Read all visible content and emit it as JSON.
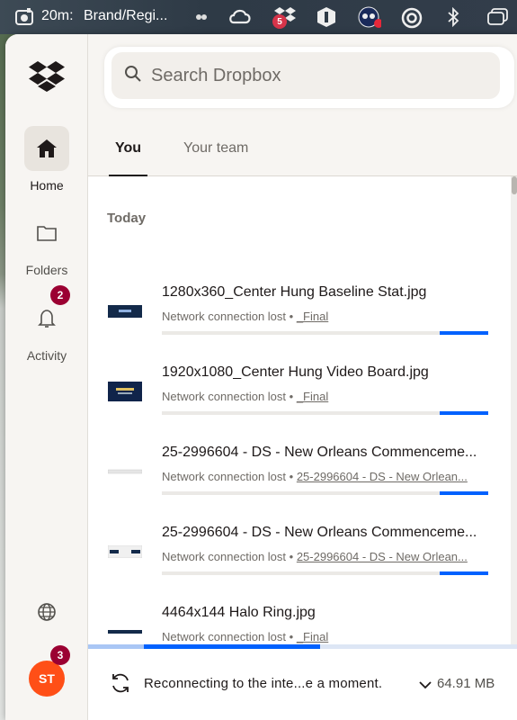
{
  "menubar": {
    "timer_label": "20m:",
    "timer_title": "Brand/Regi...",
    "dropbox_badge": "5"
  },
  "sidebar": {
    "items": [
      {
        "label": "Home",
        "icon": "home-icon"
      },
      {
        "label": "Folders",
        "icon": "folder-icon"
      },
      {
        "label": "Activity",
        "icon": "bell-icon",
        "badge": "2"
      }
    ],
    "globe_icon": "globe-icon",
    "avatar_initials": "ST",
    "avatar_badge": "3"
  },
  "search": {
    "placeholder": "Search Dropbox"
  },
  "tabs": [
    {
      "label": "You",
      "active": true
    },
    {
      "label": "Your team",
      "active": false
    }
  ],
  "section_title": "Today",
  "files": [
    {
      "name": "1280x360_Center Hung Baseline Stat.jpg",
      "status": "Network connection lost",
      "destination": "_Final",
      "progress": 0.15
    },
    {
      "name": "1920x1080_Center Hung Video Board.jpg",
      "status": "Network connection lost",
      "destination": "_Final",
      "progress": 0.15
    },
    {
      "name": "25-2996604 - DS - New Orleans Commenceme...",
      "status": "Network connection lost",
      "destination": "25-2996604 - DS - New Orlean...",
      "progress": 0.15
    },
    {
      "name": "25-2996604 - DS - New Orleans Commenceme...",
      "status": "Network connection lost",
      "destination": "25-2996604 - DS - New Orlean...",
      "progress": 0.15
    },
    {
      "name": "4464x144 Halo Ring.jpg",
      "status": "Network connection lost",
      "destination": "_Final",
      "progress": 0.15
    }
  ],
  "separator": "•",
  "footer": {
    "status_text": "Reconnecting to the inte...e a moment.",
    "size": "64.91 MB"
  },
  "overall_progress": {
    "light": 0.13,
    "strong": 0.54
  },
  "colors": {
    "accent": "#0061fe",
    "badge": "#9b0032",
    "avatar": "#ff4f17"
  }
}
